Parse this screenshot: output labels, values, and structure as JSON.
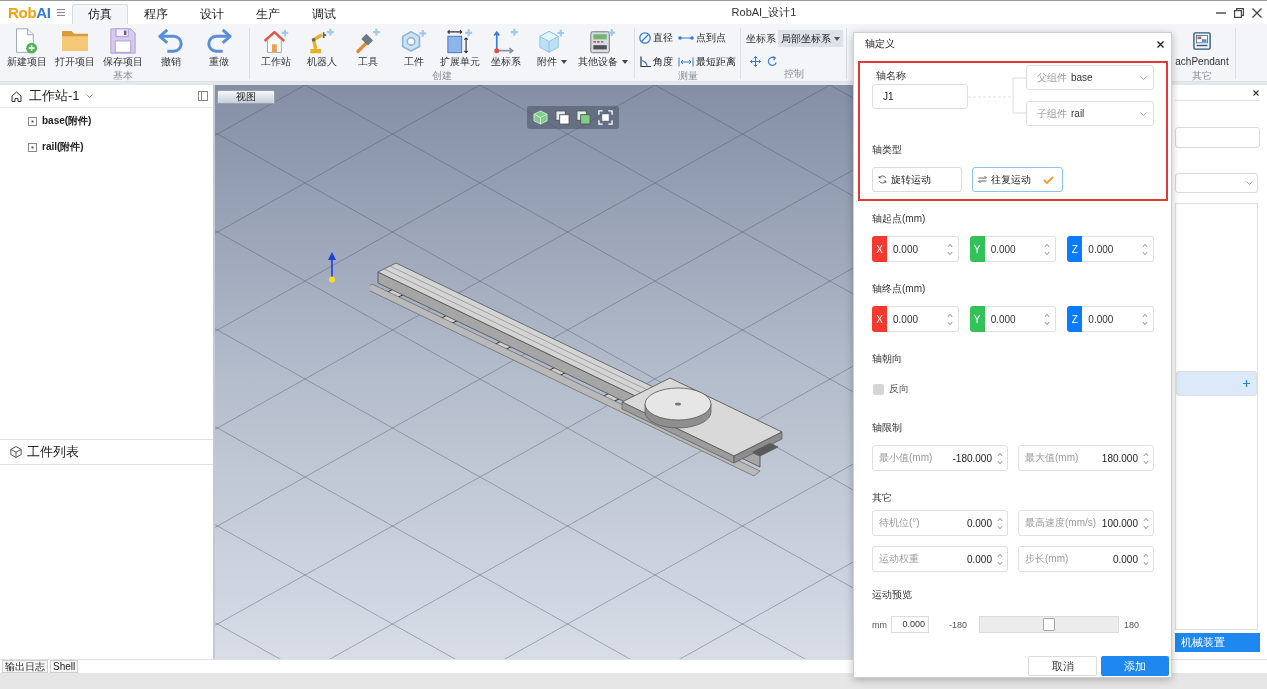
{
  "app": {
    "logo": [
      {
        "text": "Rob",
        "color": "#f2a20c"
      },
      {
        "text": "AI",
        "color": "#2f7bd8"
      }
    ],
    "title": "RobAI_设计1"
  },
  "menu_tabs": [
    {
      "label": "仿真",
      "selected": true
    },
    {
      "label": "程序",
      "selected": false
    },
    {
      "label": "设计",
      "selected": false
    },
    {
      "label": "生产",
      "selected": false
    },
    {
      "label": "调试",
      "selected": false
    }
  ],
  "ribbon": {
    "groups": [
      {
        "label": "基本",
        "kind": "large",
        "items": [
          {
            "label": "新建项目",
            "has_menu": false
          },
          {
            "label": "打开项目",
            "has_menu": false
          },
          {
            "label": "保存项目",
            "has_menu": false
          },
          {
            "label": "撤销",
            "has_menu": false
          },
          {
            "label": "重做",
            "has_menu": false
          }
        ]
      },
      {
        "label": "创建",
        "kind": "large",
        "items": [
          {
            "label": "工作站",
            "has_menu": false
          },
          {
            "label": "机器人",
            "has_menu": false
          },
          {
            "label": "工具",
            "has_menu": false
          },
          {
            "label": "工件",
            "has_menu": false
          },
          {
            "label": "扩展单元",
            "has_menu": false
          },
          {
            "label": "坐标系",
            "has_menu": false
          },
          {
            "label": "附件",
            "has_menu": true
          },
          {
            "label": "其他设备",
            "has_menu": true
          }
        ]
      },
      {
        "label": "测量",
        "kind": "small",
        "items": [
          {
            "label": "直径"
          },
          {
            "label": "点到点"
          },
          {
            "label": "角度"
          },
          {
            "label": "最短距离"
          }
        ]
      },
      {
        "label": "控制",
        "kind": "control",
        "field_label": "坐标系",
        "select_value": "局部坐标系"
      },
      {
        "label": "其它",
        "kind": "large",
        "items": [
          {
            "label": "achPendant",
            "has_menu": false
          }
        ]
      }
    ]
  },
  "workstation_panel": {
    "title": "工作站-1",
    "items": [
      {
        "label": "base(附件)",
        "selected": false
      },
      {
        "label": "rail(附件)",
        "selected": false
      }
    ]
  },
  "part_list": {
    "title": "工件列表"
  },
  "viewport": {
    "tab": "视图"
  },
  "axis_dialog": {
    "title": "轴定义",
    "name_label": "轴名称",
    "name_value": "J1",
    "parent": {
      "label": "父组件",
      "value": "base"
    },
    "child": {
      "label": "子组件",
      "value": "rail"
    },
    "type_label": "轴类型",
    "types": [
      {
        "label": "旋转运动",
        "selected": false
      },
      {
        "label": "往复运动",
        "selected": true
      }
    ],
    "start": {
      "label": "轴起点(mm)",
      "coords": [
        {
          "axis": "X",
          "value": "0.000",
          "color": "#f5392f"
        },
        {
          "axis": "Y",
          "value": "0.000",
          "color": "#33c25a"
        },
        {
          "axis": "Z",
          "value": "0.000",
          "color": "#0b7bff"
        }
      ]
    },
    "end": {
      "label": "轴终点(mm)",
      "coords": [
        {
          "axis": "X",
          "value": "0.000",
          "color": "#f5392f"
        },
        {
          "axis": "Y",
          "value": "0.000",
          "color": "#33c25a"
        },
        {
          "axis": "Z",
          "value": "0.000",
          "color": "#0b7bff"
        }
      ]
    },
    "direction": {
      "label": "轴朝向",
      "option": "反向",
      "checked": false
    },
    "limits": {
      "label": "轴限制",
      "fields": [
        {
          "label": "最小值(mm)",
          "value": "-180.000"
        },
        {
          "label": "最大值(mm)",
          "value": "180.000"
        }
      ]
    },
    "other": {
      "label": "其它",
      "fields": [
        {
          "label": "待机位(°)",
          "value": "0.000"
        },
        {
          "label": "最高速度(mm/s)",
          "value": "100.000"
        },
        {
          "label": "运动权重",
          "value": "0.000"
        },
        {
          "label": "步长(mm)",
          "value": "0.000"
        }
      ]
    },
    "preview": {
      "label": "运动预览",
      "unit": "mm",
      "value": "0.000",
      "min": "-180",
      "max": "180",
      "level": 0.5
    },
    "buttons": [
      {
        "label": "取消",
        "kind": "secondary"
      },
      {
        "label": "添加",
        "kind": "primary"
      }
    ]
  },
  "right_panel": {
    "rows": [
      {
        "selected": true
      }
    ],
    "button": "机械装置"
  },
  "bottom_tabs": [
    {
      "label": "输出日志"
    },
    {
      "label": "Shell"
    }
  ]
}
